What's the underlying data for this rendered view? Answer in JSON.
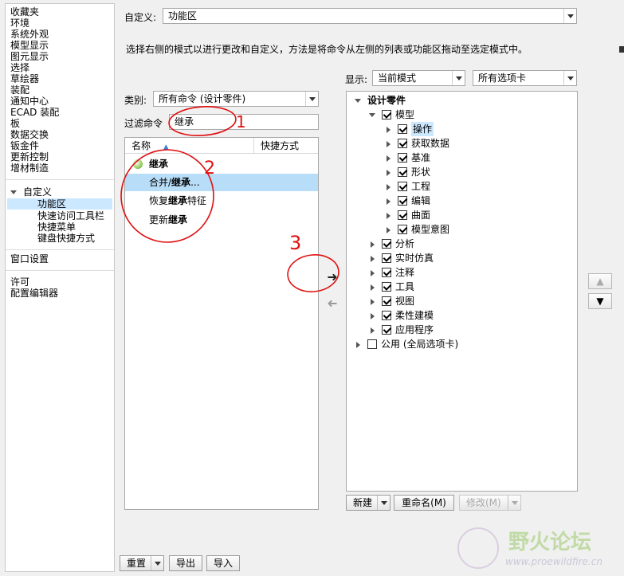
{
  "nav": {
    "items": [
      "收藏夹",
      "环境",
      "系统外观",
      "模型显示",
      "图元显示",
      "选择",
      "草绘器",
      "装配",
      "通知中心",
      "ECAD 装配",
      "板",
      "数据交换",
      "钣金件",
      "更新控制",
      "增材制造"
    ],
    "customize": "自定义",
    "sub_items": [
      "功能区",
      "快速访问工具栏",
      "快捷菜单",
      "键盘快捷方式"
    ],
    "window_settings": "窗口设置",
    "license": "许可",
    "config_editor": "配置编辑器"
  },
  "header": {
    "customize_label": "自定义:",
    "customize_value": "功能区",
    "instruction": "选择右侧的模式以进行更改和自定义，方法是将命令从左侧的列表或功能区拖动至选定模式中。"
  },
  "left_panel": {
    "category_label": "类别:",
    "category_value": "所有命令 (设计零件)",
    "filter_label": "过滤命令",
    "filter_value": "继承",
    "col_name": "名称",
    "col_shortcut": "快捷方式",
    "rows": [
      {
        "pre": "",
        "bold": "继承",
        "post": ""
      },
      {
        "pre": "合并/",
        "bold": "继承",
        "post": "..."
      },
      {
        "pre": "恢复",
        "bold": "继承",
        "post": "特征"
      },
      {
        "pre": "更新",
        "bold": "继承",
        "post": ""
      }
    ]
  },
  "right_panel": {
    "display_label": "显示:",
    "mode_value": "当前模式",
    "tabs_value": "所有选项卡",
    "tree": {
      "root": "设计零件",
      "model": "模型",
      "model_children": [
        "操作",
        "获取数据",
        "基准",
        "形状",
        "工程",
        "编辑",
        "曲面",
        "模型意图"
      ],
      "siblings": [
        "分析",
        "实时仿真",
        "注释",
        "工具",
        "视图",
        "柔性建模",
        "应用程序"
      ],
      "common": "公用 (全局选项卡)"
    },
    "btn_new": "新建",
    "btn_rename": "重命名(M)",
    "btn_modify": "修改(M)"
  },
  "bottom": {
    "reset": "重置",
    "export": "导出",
    "import": "导入"
  },
  "annotations": [
    "1",
    "2",
    "3"
  ],
  "watermark": {
    "text": "野火论坛",
    "url": "www.proewildfire.cn"
  }
}
